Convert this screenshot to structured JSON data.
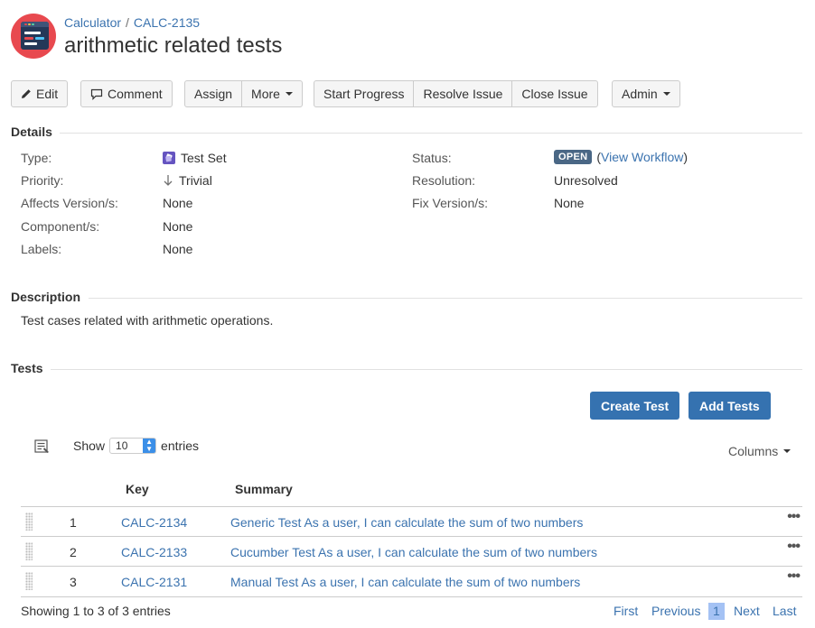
{
  "header": {
    "project": "Calculator",
    "issue_key": "CALC-2135",
    "separator": "/",
    "title": "arithmetic related tests"
  },
  "toolbar": {
    "edit": "Edit",
    "comment": "Comment",
    "assign": "Assign",
    "more": "More",
    "start_progress": "Start Progress",
    "resolve_issue": "Resolve Issue",
    "close_issue": "Close Issue",
    "admin": "Admin"
  },
  "details": {
    "heading": "Details",
    "type_label": "Type:",
    "type_value": "Test Set",
    "priority_label": "Priority:",
    "priority_value": "Trivial",
    "affects_label": "Affects Version/s:",
    "affects_value": "None",
    "component_label": "Component/s:",
    "component_value": "None",
    "labels_label": "Labels:",
    "labels_value": "None",
    "status_label": "Status:",
    "status_value": "OPEN",
    "status_paren_open": "(",
    "view_workflow": "View Workflow",
    "status_paren_close": ")",
    "resolution_label": "Resolution:",
    "resolution_value": "Unresolved",
    "fix_label": "Fix Version/s:",
    "fix_value": "None"
  },
  "description": {
    "heading": "Description",
    "text": "Test cases related with arithmetic operations."
  },
  "tests": {
    "heading": "Tests",
    "create_test": "Create Test",
    "add_tests": "Add Tests",
    "show_label": "Show",
    "show_value": "10",
    "entries_label": "entries",
    "columns_label": "Columns",
    "col_key": "Key",
    "col_summary": "Summary",
    "rows": [
      {
        "num": "1",
        "key": "CALC-2134",
        "summary": "Generic Test As a user, I can calculate the sum of two numbers"
      },
      {
        "num": "2",
        "key": "CALC-2133",
        "summary": "Cucumber Test As a user, I can calculate the sum of two numbers"
      },
      {
        "num": "3",
        "key": "CALC-2131",
        "summary": "Manual Test As a user, I can calculate the sum of two numbers"
      }
    ],
    "row_menu": "•••",
    "showing_text": "Showing 1 to 3 of 3 entries",
    "pager": {
      "first": "First",
      "previous": "Previous",
      "current": "1",
      "next": "Next",
      "last": "Last"
    }
  },
  "colors": {
    "link": "#3b73af",
    "primary": "#3572b0",
    "lozenge": "#4a6785",
    "avatar": "#e8494f"
  }
}
